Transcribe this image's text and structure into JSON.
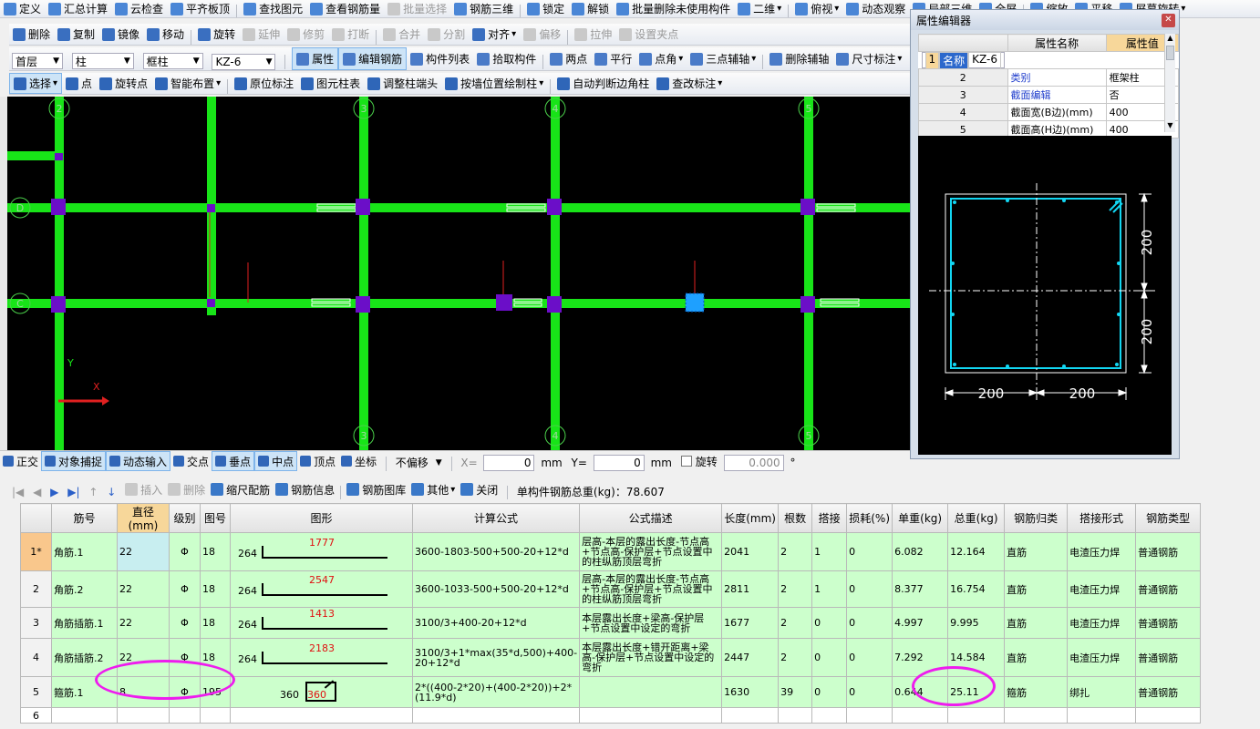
{
  "menubar": {
    "items": [
      {
        "label": "定义",
        "dis": false
      },
      {
        "label": "汇总计算",
        "dis": false
      },
      {
        "label": "云检查",
        "dis": false
      },
      {
        "label": "平齐板顶",
        "dis": false
      },
      {
        "label": "查找图元",
        "dis": false
      },
      {
        "label": "查看钢筋量",
        "dis": false
      },
      {
        "label": "批量选择",
        "dis": true
      },
      {
        "label": "钢筋三维",
        "dis": false
      },
      {
        "label": "锁定",
        "dis": false
      },
      {
        "label": "解锁",
        "dis": false
      },
      {
        "label": "批量删除未使用构件",
        "dis": false
      },
      {
        "label": "二维",
        "dis": false,
        "dd": true
      },
      {
        "label": "俯视",
        "dis": false,
        "dd": true
      },
      {
        "label": "动态观察",
        "dis": false
      },
      {
        "label": "局部三维",
        "dis": false
      },
      {
        "label": "全屏",
        "dis": false
      },
      {
        "label": "缩放",
        "dis": false
      },
      {
        "label": "平移",
        "dis": false
      },
      {
        "label": "屏幕旋转",
        "dis": false,
        "dd": true
      }
    ]
  },
  "editbar": {
    "items": [
      {
        "label": "删除",
        "dis": false
      },
      {
        "label": "复制",
        "dis": false
      },
      {
        "label": "镜像",
        "dis": false
      },
      {
        "label": "移动",
        "dis": false
      },
      {
        "label": "旋转",
        "dis": false
      },
      {
        "label": "延伸",
        "dis": true
      },
      {
        "label": "修剪",
        "dis": true
      },
      {
        "label": "打断",
        "dis": true
      },
      {
        "label": "合并",
        "dis": true
      },
      {
        "label": "分割",
        "dis": true
      },
      {
        "label": "对齐",
        "dis": false,
        "dd": true
      },
      {
        "label": "偏移",
        "dis": true
      },
      {
        "label": "拉伸",
        "dis": true
      },
      {
        "label": "设置夹点",
        "dis": true
      }
    ]
  },
  "selectors": {
    "floor": "首层",
    "category": "柱",
    "type": "框柱",
    "name": "KZ-6"
  },
  "compbar": {
    "items": [
      {
        "label": "属性",
        "dis": false,
        "act": true
      },
      {
        "label": "编辑钢筋",
        "dis": false,
        "act": true
      },
      {
        "label": "构件列表",
        "dis": false
      },
      {
        "label": "拾取构件",
        "dis": false
      },
      {
        "label": "两点",
        "dis": false
      },
      {
        "label": "平行",
        "dis": false
      },
      {
        "label": "点角",
        "dis": false,
        "dd": true
      },
      {
        "label": "三点辅轴",
        "dis": false,
        "dd": true
      },
      {
        "label": "删除辅轴",
        "dis": false
      },
      {
        "label": "尺寸标注",
        "dis": false,
        "dd": true
      }
    ]
  },
  "drawbar": {
    "items": [
      {
        "label": "选择",
        "dis": false,
        "act": true,
        "dd": true
      },
      {
        "label": "点",
        "dis": false
      },
      {
        "label": "旋转点",
        "dis": false
      },
      {
        "label": "智能布置",
        "dis": false,
        "dd": true
      },
      {
        "label": "原位标注",
        "dis": false
      },
      {
        "label": "图元柱表",
        "dis": false
      },
      {
        "label": "调整柱端头",
        "dis": false
      },
      {
        "label": "按墙位置绘制柱",
        "dis": false,
        "dd": true
      },
      {
        "label": "自动判断边角柱",
        "dis": false
      },
      {
        "label": "查改标注",
        "dis": false,
        "dd": true
      }
    ]
  },
  "canvas": {
    "axis_top": [
      "2",
      "3",
      "4",
      "5"
    ],
    "axis_bottom": [
      "3",
      "4",
      "5"
    ],
    "axis_left": [
      "D",
      "C"
    ],
    "ucs_y": "Y",
    "ucs_x": "X"
  },
  "snapbar": {
    "items": [
      {
        "label": "正交",
        "act": false
      },
      {
        "label": "对象捕捉",
        "act": true
      },
      {
        "label": "动态输入",
        "act": true
      },
      {
        "label": "交点",
        "act": false
      },
      {
        "label": "垂点",
        "act": true
      },
      {
        "label": "中点",
        "act": true
      },
      {
        "label": "顶点",
        "act": false
      },
      {
        "label": "坐标",
        "act": false
      }
    ],
    "offset_mode": "不偏移",
    "x_label": "X=",
    "x_value": "0",
    "y_label": "Y=",
    "y_value": "0",
    "unit": "mm",
    "rotate_label": "旋转",
    "rotate_value": "0.000",
    "degree": "°"
  },
  "rebar_toolbar": {
    "items": [
      {
        "label": "插入",
        "dis": true
      },
      {
        "label": "删除",
        "dis": true
      },
      {
        "label": "缩尺配筋",
        "dis": false
      },
      {
        "label": "钢筋信息",
        "dis": false
      },
      {
        "label": "钢筋图库",
        "dis": false
      },
      {
        "label": "其他",
        "dis": false,
        "dd": true
      },
      {
        "label": "关闭",
        "dis": false
      }
    ],
    "total_weight": "单构件钢筋总重(kg)：78.607"
  },
  "rebar_table": {
    "columns": [
      "",
      "筋号",
      "直径(mm)",
      "级别",
      "图号",
      "图形",
      "计算公式",
      "公式描述",
      "长度(mm)",
      "根数",
      "搭接",
      "损耗(%)",
      "单重(kg)",
      "总重(kg)",
      "钢筋归类",
      "搭接形式",
      "钢筋类型"
    ],
    "rows": [
      {
        "rn": "1*",
        "name": "角筋.1",
        "dia": "22",
        "grade": "Φ",
        "fig": "18",
        "shape_left": "264",
        "shape_len": "1777",
        "formula": "3600-1803-500+500-20+12*d",
        "desc": "层高-本层的露出长度-节点高+节点高-保护层+节点设置中的柱纵筋顶层弯折",
        "length": "2041",
        "count": "2",
        "lap": "1",
        "loss": "0",
        "unit_w": "6.082",
        "total_w": "12.164",
        "class": "直筋",
        "lap_form": "电渣压力焊",
        "type": "普通钢筋"
      },
      {
        "rn": "2",
        "name": "角筋.2",
        "dia": "22",
        "grade": "Φ",
        "fig": "18",
        "shape_left": "264",
        "shape_len": "2547",
        "formula": "3600-1033-500+500-20+12*d",
        "desc": "层高-本层的露出长度-节点高+节点高-保护层+节点设置中的柱纵筋顶层弯折",
        "length": "2811",
        "count": "2",
        "lap": "1",
        "loss": "0",
        "unit_w": "8.377",
        "total_w": "16.754",
        "class": "直筋",
        "lap_form": "电渣压力焊",
        "type": "普通钢筋"
      },
      {
        "rn": "3",
        "name": "角筋插筋.1",
        "dia": "22",
        "grade": "Φ",
        "fig": "18",
        "shape_left": "264",
        "shape_len": "1413",
        "formula": "3100/3+400-20+12*d",
        "desc": "本层露出长度+梁高-保护层+节点设置中设定的弯折",
        "length": "1677",
        "count": "2",
        "lap": "0",
        "loss": "0",
        "unit_w": "4.997",
        "total_w": "9.995",
        "class": "直筋",
        "lap_form": "电渣压力焊",
        "type": "普通钢筋"
      },
      {
        "rn": "4",
        "name": "角筋插筋.2",
        "dia": "22",
        "grade": "Φ",
        "fig": "18",
        "shape_left": "264",
        "shape_len": "2183",
        "formula": "3100/3+1*max(35*d,500)+400-20+12*d",
        "desc": "本层露出长度+错开距离+梁高-保护层+节点设置中设定的弯折",
        "length": "2447",
        "count": "2",
        "lap": "0",
        "loss": "0",
        "unit_w": "7.292",
        "total_w": "14.584",
        "class": "直筋",
        "lap_form": "电渣压力焊",
        "type": "普通钢筋"
      },
      {
        "rn": "5",
        "name": "箍筋.1",
        "dia": "8",
        "grade": "Φ",
        "fig": "195",
        "shape_left": "360",
        "shape_len": "360",
        "formula": "2*((400-2*20)+(400-2*20))+2*(11.9*d)",
        "desc": "",
        "length": "1630",
        "count": "39",
        "lap": "0",
        "loss": "0",
        "unit_w": "0.644",
        "total_w": "25.11",
        "class": "箍筋",
        "lap_form": "绑扎",
        "type": "普通钢筋"
      },
      {
        "rn": "6",
        "name": "",
        "dia": "",
        "grade": "",
        "fig": "",
        "shape_left": "",
        "shape_len": "",
        "formula": "",
        "desc": "",
        "length": "",
        "count": "",
        "lap": "",
        "loss": "",
        "unit_w": "",
        "total_w": "",
        "class": "",
        "lap_form": "",
        "type": ""
      }
    ]
  },
  "property_editor": {
    "title": "属性编辑器",
    "col_name": "属性名称",
    "col_value": "属性值",
    "rows": [
      {
        "idx": "1",
        "name": "名称",
        "value": "KZ-6",
        "blue": true
      },
      {
        "idx": "2",
        "name": "类别",
        "value": "框架柱",
        "blue": true
      },
      {
        "idx": "3",
        "name": "截面编辑",
        "value": "否",
        "blue": true
      },
      {
        "idx": "4",
        "name": "截面宽(B边)(mm)",
        "value": "400",
        "blue": false
      },
      {
        "idx": "5",
        "name": "截面高(H边)(mm)",
        "value": "400",
        "blue": false
      }
    ],
    "section_dims": {
      "right_top": "200",
      "right_bottom": "200",
      "bottom_left": "200",
      "bottom_right": "200"
    }
  }
}
